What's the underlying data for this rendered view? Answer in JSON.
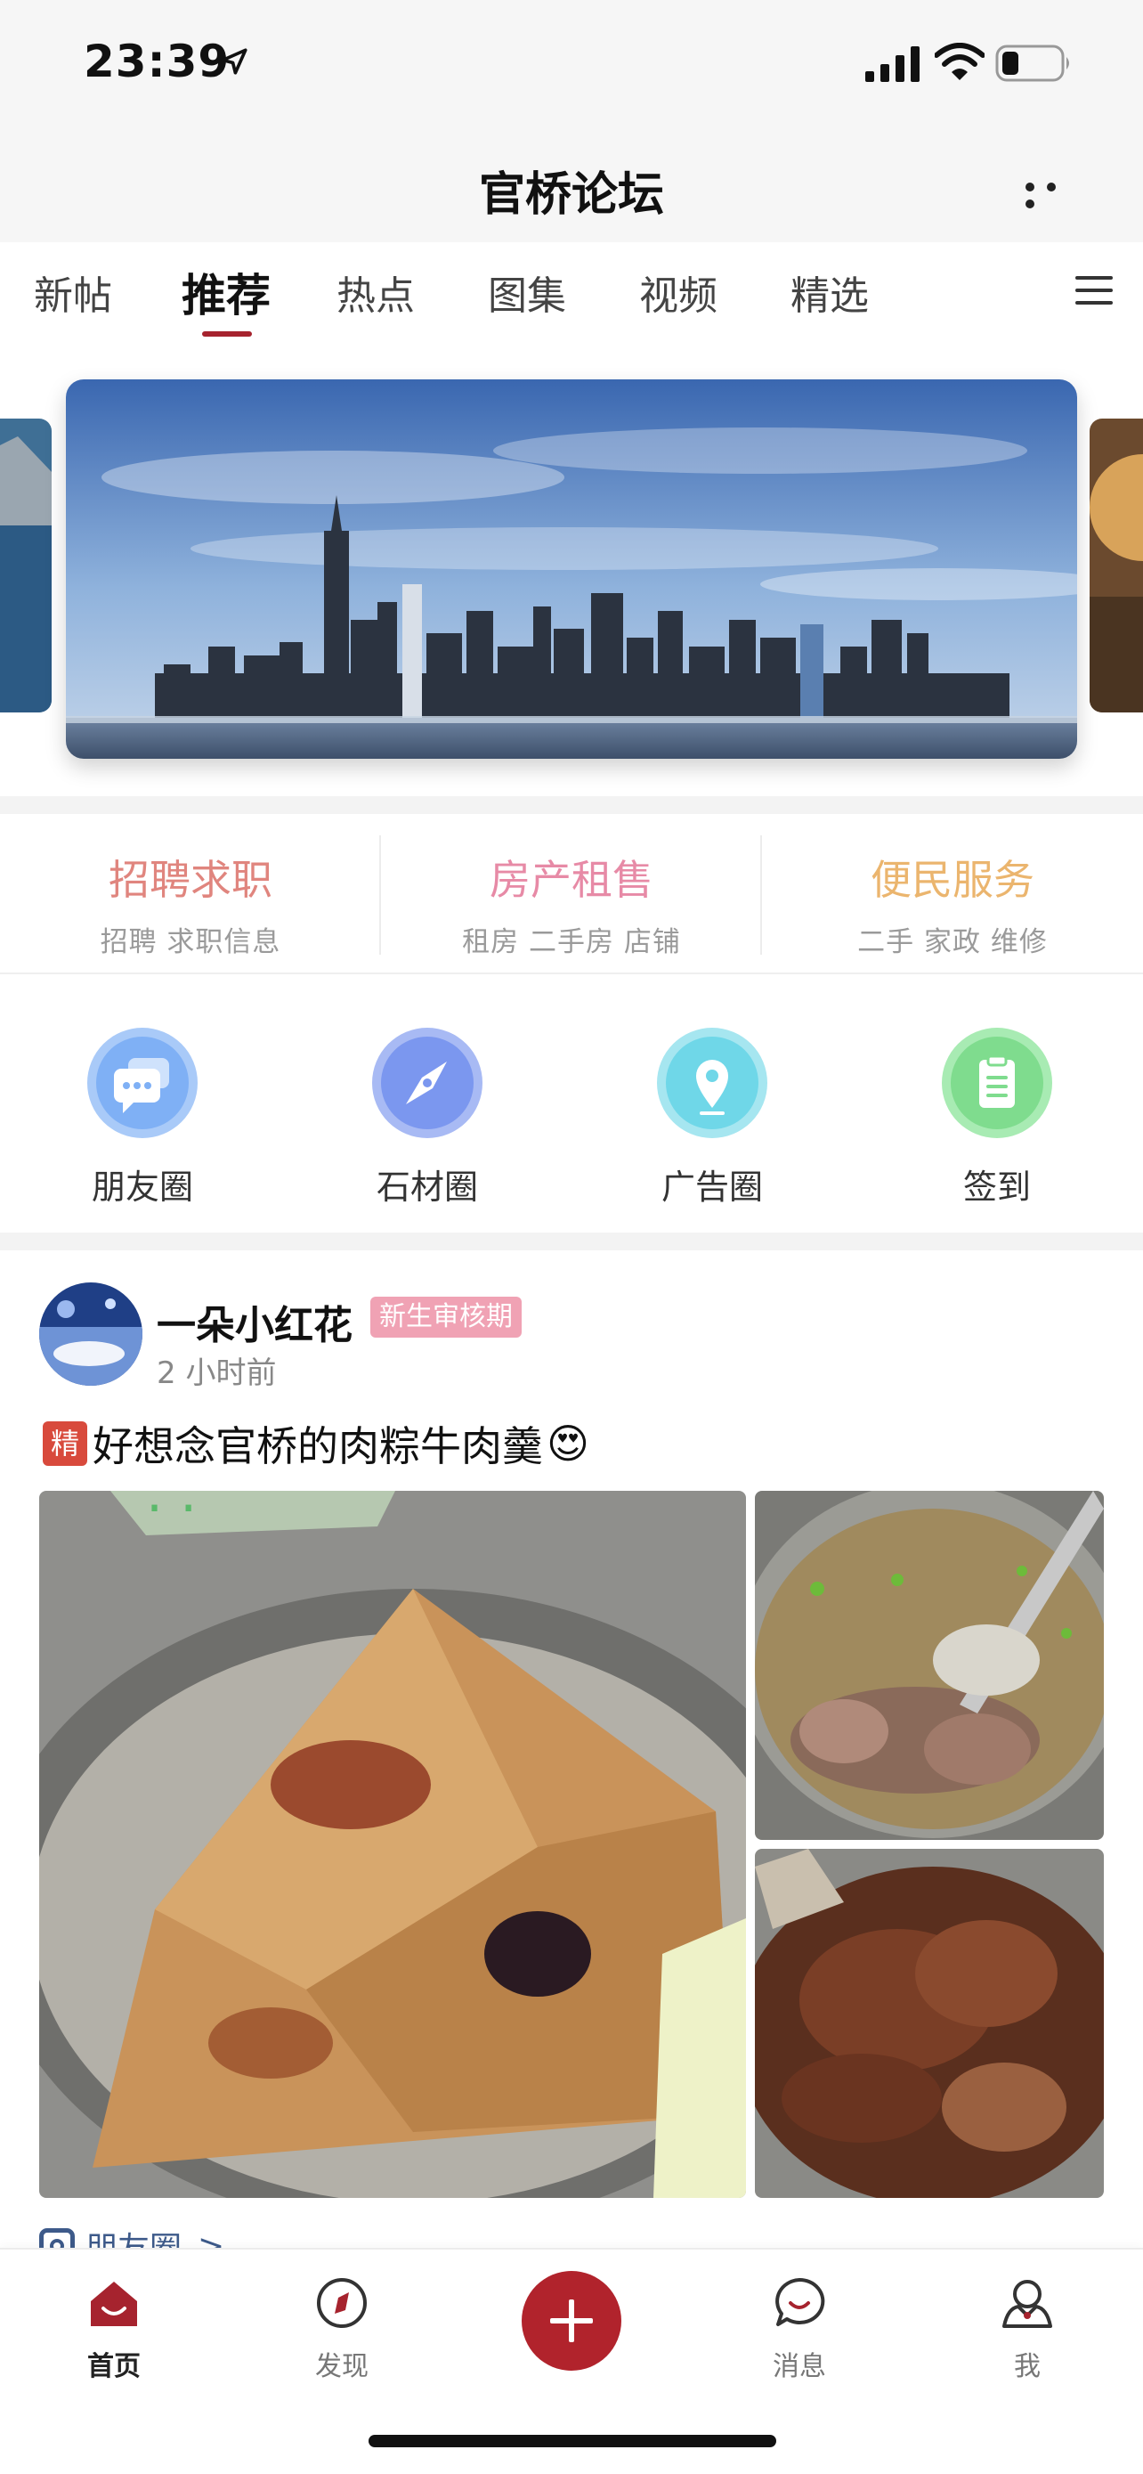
{
  "status_bar": {
    "time": "23:39"
  },
  "nav": {
    "title": "官桥论坛"
  },
  "tabs": [
    {
      "label": "新帖"
    },
    {
      "label": "推荐"
    },
    {
      "label": "热点"
    },
    {
      "label": "图集"
    },
    {
      "label": "视频"
    },
    {
      "label": "精选"
    }
  ],
  "active_tab": "推荐",
  "categories": [
    {
      "title": "招聘求职",
      "subtitle": "招聘 求职信息",
      "color": "#e0857e"
    },
    {
      "title": "房产租售",
      "subtitle": "租房 二手房 店铺",
      "color": "#e78aa6"
    },
    {
      "title": "便民服务",
      "subtitle": "二手 家政 维修",
      "color": "#ebb56e"
    }
  ],
  "circles": [
    {
      "label": "朋友圈",
      "icon": "chat-bubbles-icon",
      "color": "#7fb0f5"
    },
    {
      "label": "石材圈",
      "icon": "compass-icon",
      "color": "#7b97ef"
    },
    {
      "label": "广告圈",
      "icon": "location-pin-icon",
      "color": "#6fd7e8"
    },
    {
      "label": "签到",
      "icon": "clipboard-icon",
      "color": "#7fdc8e"
    }
  ],
  "post": {
    "author": "一朵小红花",
    "badge": "新生审核期",
    "time": "2 小时前",
    "tag": "精",
    "title": "好想念官桥的肉粽牛肉羹",
    "emoji": "😍",
    "circle_tag": "朋友圈",
    "circle_tag_arrow": ">"
  },
  "tabbar": [
    {
      "label": "首页",
      "icon": "home-icon",
      "active": true
    },
    {
      "label": "发现",
      "icon": "discover-icon",
      "active": false
    },
    {
      "label": "",
      "icon": "plus-icon",
      "active": false
    },
    {
      "label": "消息",
      "icon": "message-icon",
      "active": false
    },
    {
      "label": "我",
      "icon": "profile-icon",
      "active": false
    }
  ],
  "colors": {
    "accent": "#a6232e",
    "background": "#f6f6f6"
  }
}
